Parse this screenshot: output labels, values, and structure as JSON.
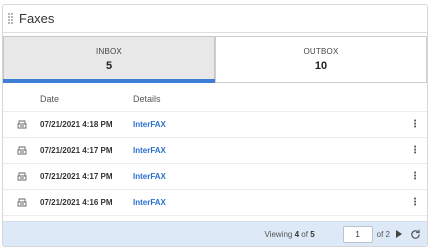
{
  "header": {
    "title": "Faxes"
  },
  "tabs": [
    {
      "label": "INBOX",
      "count": "5",
      "active": true
    },
    {
      "label": "OUTBOX",
      "count": "10",
      "active": false
    }
  ],
  "table": {
    "columns": {
      "date": "Date",
      "details": "Details"
    },
    "rows": [
      {
        "date": "07/21/2021 4:18 PM",
        "details": "InterFAX",
        "icon": "fax-icon"
      },
      {
        "date": "07/21/2021 4:17 PM",
        "details": "InterFAX",
        "icon": "fax-icon"
      },
      {
        "date": "07/21/2021 4:17 PM",
        "details": "InterFAX",
        "icon": "fax-icon"
      },
      {
        "date": "07/21/2021 4:16 PM",
        "details": "InterFAX",
        "icon": "fax-icon"
      }
    ]
  },
  "footer": {
    "viewing_prefix": "Viewing",
    "viewing_count": "4",
    "viewing_of": "of",
    "viewing_total": "5",
    "page_value": "1",
    "of_pages": "of 2"
  },
  "colors": {
    "accent": "#3d7fd6",
    "link": "#2b6fcf",
    "footer_bg": "#dde9f6"
  }
}
